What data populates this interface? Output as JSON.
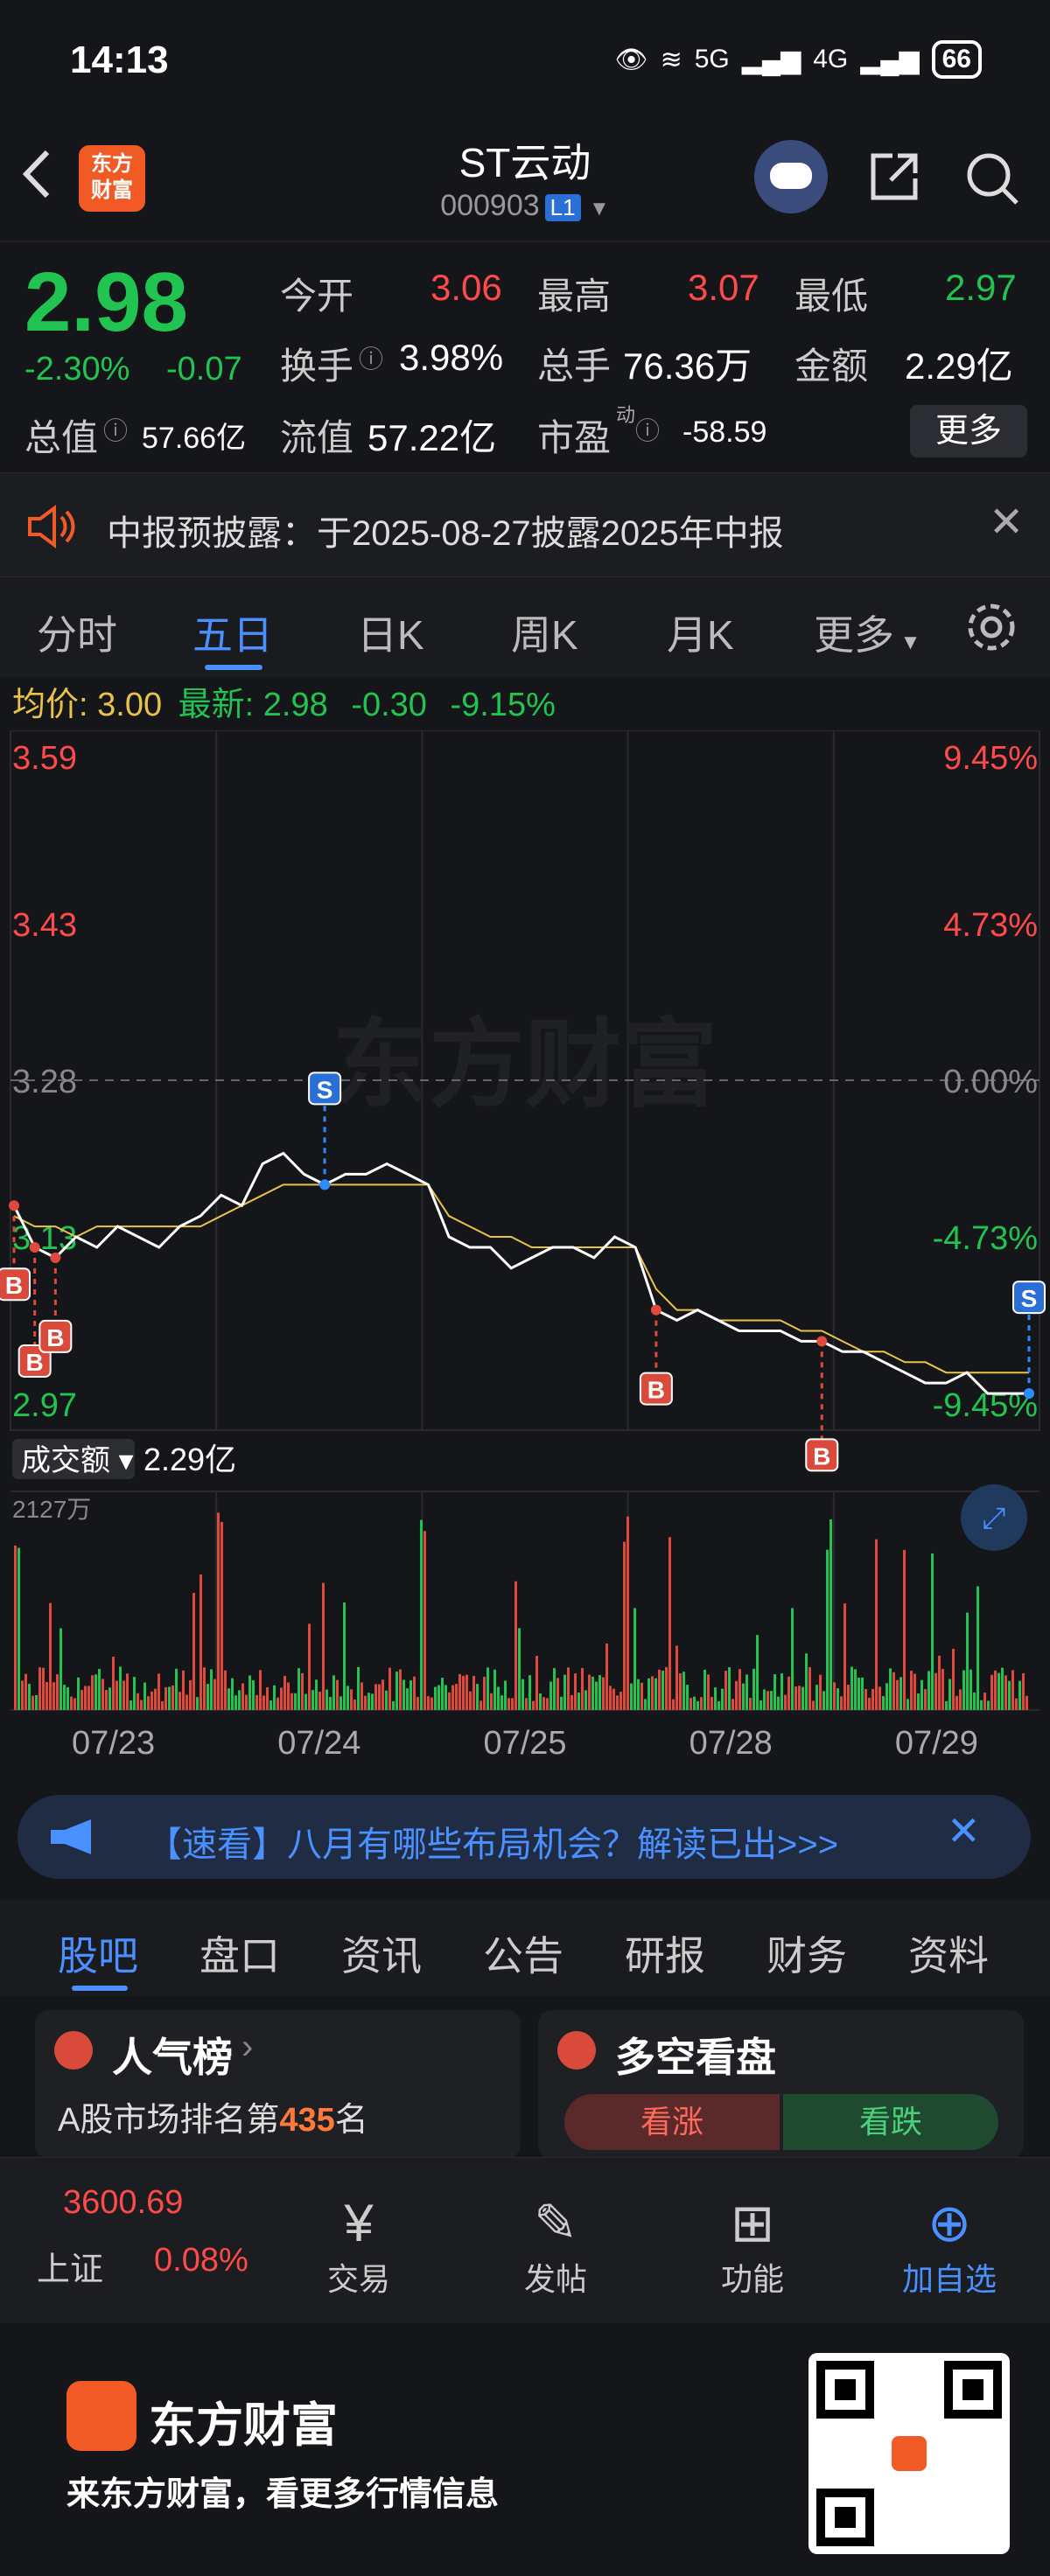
{
  "status": {
    "time": "14:13",
    "net1": "5G",
    "net2": "4G",
    "battery": "66"
  },
  "nav": {
    "back_label": "<",
    "logo_text": "东方\n财富",
    "stock_name": "ST云动",
    "stock_code": "000903",
    "level": "L1"
  },
  "quote": {
    "price": "2.98",
    "change_pct": "-2.30%",
    "change": "-0.07",
    "open_label": "今开",
    "open": "3.06",
    "high_label": "最高",
    "high": "3.07",
    "low_label": "最低",
    "low": "2.97",
    "turnover_label": "换手",
    "turnover": "3.98%",
    "volume_label": "总手",
    "volume": "76.36万",
    "amount_label": "金额",
    "amount": "2.29亿",
    "mcap_label": "总值",
    "mcap": "57.66亿",
    "float_label": "流值",
    "float_cap": "57.22亿",
    "pe_label": "市盈",
    "pe_sup": "动",
    "pe": "-58.59",
    "more_label": "更多"
  },
  "notice": {
    "text": "中报预披露：于2025-08-27披露2025年中报"
  },
  "tabs": [
    "分时",
    "五日",
    "日K",
    "周K",
    "月K",
    "更多"
  ],
  "avg": {
    "label_avg": "均价:",
    "avg": "3.00",
    "label_latest": "最新:",
    "latest": "2.98",
    "chg": "-0.30",
    "pct": "-9.15%"
  },
  "chart_data": {
    "type": "line",
    "y_ticks_left": [
      "3.59",
      "3.43",
      "3.28",
      "3.13",
      "2.97"
    ],
    "y_ticks_right": [
      "9.45%",
      "4.73%",
      "0.00%",
      "-4.73%",
      "-9.45%"
    ],
    "ylim": [
      2.97,
      3.59
    ],
    "x": [
      "07/23",
      "07/24",
      "07/25",
      "07/28",
      "07/29"
    ],
    "price_series": [
      3.16,
      3.12,
      3.11,
      3.13,
      3.12,
      3.14,
      3.13,
      3.12,
      3.14,
      3.15,
      3.17,
      3.16,
      3.2,
      3.21,
      3.19,
      3.18,
      3.19,
      3.19,
      3.2,
      3.19,
      3.18,
      3.13,
      3.12,
      3.12,
      3.1,
      3.11,
      3.12,
      3.12,
      3.11,
      3.13,
      3.12,
      3.06,
      3.05,
      3.06,
      3.05,
      3.04,
      3.04,
      3.04,
      3.03,
      3.03,
      3.02,
      3.02,
      3.01,
      3.0,
      2.99,
      2.99,
      3.0,
      2.98,
      2.98,
      2.98
    ],
    "avg_series": [
      3.15,
      3.14,
      3.14,
      3.13,
      3.14,
      3.14,
      3.14,
      3.14,
      3.14,
      3.14,
      3.15,
      3.16,
      3.17,
      3.18,
      3.18,
      3.18,
      3.18,
      3.18,
      3.18,
      3.18,
      3.18,
      3.15,
      3.14,
      3.13,
      3.13,
      3.12,
      3.12,
      3.12,
      3.12,
      3.12,
      3.12,
      3.08,
      3.06,
      3.06,
      3.05,
      3.05,
      3.05,
      3.05,
      3.04,
      3.04,
      3.03,
      3.02,
      3.02,
      3.01,
      3.01,
      3.0,
      3.0,
      3.0,
      3.0,
      3.0
    ],
    "markers": [
      {
        "type": "B",
        "index": 0
      },
      {
        "type": "B",
        "index": 1
      },
      {
        "type": "B",
        "index": 2
      },
      {
        "type": "S",
        "index": 15
      },
      {
        "type": "B",
        "index": 31
      },
      {
        "type": "B",
        "index": 39
      },
      {
        "type": "S",
        "index": 49
      }
    ],
    "volume_label": "成交额",
    "volume_total": "2.29亿",
    "volume_max": "2127万",
    "watermark": "东方财富"
  },
  "ad": {
    "text": "【速看】八月有哪些布局机会？解读已出>>>"
  },
  "subtabs": [
    "股吧",
    "盘口",
    "资讯",
    "公告",
    "研报",
    "财务",
    "资料"
  ],
  "cards": {
    "left_title": "人气榜",
    "left_text_prefix": "A股市场排名第",
    "left_rank": "435",
    "left_text_suffix": "名",
    "right_title": "多空看盘",
    "bull": "看涨",
    "bear": "看跌"
  },
  "bottomnav": {
    "index_value": "3600.69",
    "index_name": "上证",
    "index_pct": "0.08%",
    "items": [
      "交易",
      "发帖",
      "功能",
      "加自选"
    ]
  },
  "footer": {
    "brand": "东方财富",
    "slogan": "来东方财富，看更多行情信息"
  },
  "colors": {
    "up": "#ff4a4a",
    "down": "#21c451",
    "accent": "#4a90ff",
    "bg": "#151619"
  }
}
